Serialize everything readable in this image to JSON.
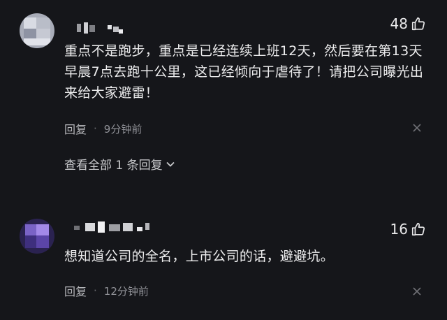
{
  "comments": [
    {
      "likes": "48",
      "text": "重点不是跑步，重点是已经连续上班12天，然后要在第13天早晨7点去跑十公里，这已经倾向于虐待了！请把公司曝光出来给大家避雷！",
      "reply_label": "回复",
      "time": "9分钟前",
      "expand_label": "查看全部 1 条回复"
    },
    {
      "likes": "16",
      "text": "想知道公司的全名，上市公司的话，避避坑。",
      "reply_label": "回复",
      "time": "12分钟前"
    }
  ],
  "separator": "·",
  "icons": {
    "like": "thumbs-up-icon",
    "close": "close-icon",
    "expand": "chevron-down-icon"
  },
  "colors": {
    "background": "#15161a",
    "text": "#ededee",
    "muted": "#8f9096"
  }
}
